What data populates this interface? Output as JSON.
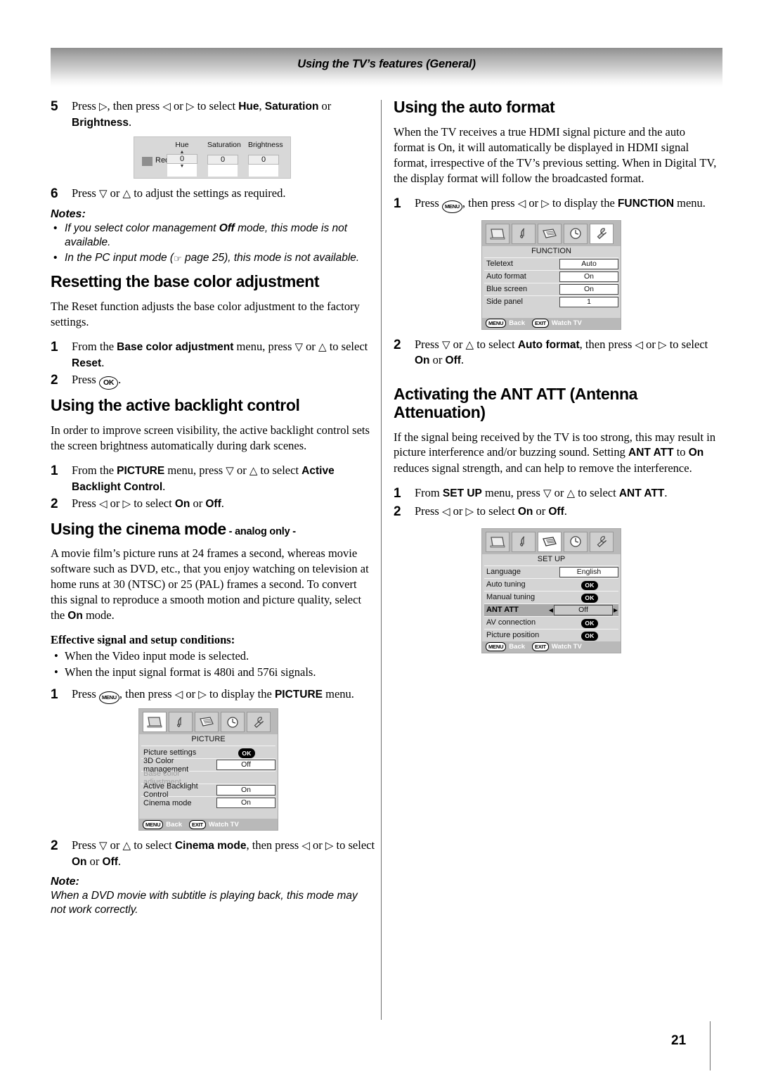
{
  "header": {
    "title": "Using the TV’s features (General)"
  },
  "page": {
    "number": "21"
  },
  "left": {
    "step5": {
      "num": "5",
      "t1": "Press ",
      "arrow1": "▷",
      "t2": ", then press ",
      "arrow2": "◁",
      "t3": " or ",
      "arrow3": "▷",
      "t4": " to select ",
      "b1": "Hue",
      "t5": ", ",
      "b2": "Saturation",
      "t6": " or ",
      "b3": "Brightness",
      "t7": "."
    },
    "hsb": {
      "swatch_label": "Red",
      "columns": [
        {
          "label": "Hue",
          "value": "0",
          "spinner": true
        },
        {
          "label": "Saturation",
          "value": "0",
          "spinner": false
        },
        {
          "label": "Brightness",
          "value": "0",
          "spinner": false
        }
      ]
    },
    "step6": {
      "num": "6",
      "t1": "Press ",
      "arrow1": "▽",
      "t2": " or ",
      "arrow2": "△",
      "t3": " to adjust the settings as required."
    },
    "notes_title": "Notes:",
    "notes": [
      {
        "a": "If you select color management ",
        "b": "Off",
        "c": " mode, this mode is not available."
      },
      {
        "a": "In the PC input mode (",
        "hand": "☞",
        "b": " page 25",
        "c": "), this mode is not available."
      }
    ],
    "reset": {
      "heading": "Resetting the base color adjustment",
      "body": "The Reset function adjusts the base color adjustment to the factory settings.",
      "step1": {
        "num": "1",
        "t1": "From the ",
        "b1": "Base color adjustment",
        "t2": " menu, press ",
        "arrow1": "▽",
        "t3": " or ",
        "arrow2": "△",
        "t4": " to select ",
        "b2": "Reset",
        "t5": "."
      },
      "step2": {
        "num": "2",
        "t1": "Press ",
        "key": "OK",
        "t2": "."
      }
    },
    "backlight": {
      "heading": "Using the active backlight control",
      "body": "In order to improve screen visibility, the active backlight control sets the screen brightness automatically during dark scenes.",
      "step1": {
        "num": "1",
        "t1": "From the ",
        "b1": "PICTURE",
        "t2": " menu, press ",
        "arrow1": "▽",
        "t3": " or ",
        "arrow2": "△",
        "t4": " to select ",
        "b2": "Active Backlight Control",
        "t5": "."
      },
      "step2": {
        "num": "2",
        "t1": "Press ",
        "arrow1": "◁",
        "t2": " or ",
        "arrow2": "▷",
        "t3": " to select ",
        "b1": "On",
        "t4": " or ",
        "b2": "Off",
        "t5": "."
      }
    },
    "cinema": {
      "heading": "Using the cinema mode",
      "heading_suffix": " - analog only -",
      "body1": "A movie film’s picture runs at 24 frames a second, whereas movie software such as DVD, etc., that you enjoy watching on television at home runs at 30 (NTSC) or 25 (PAL) frames a second. To convert this signal to reproduce a smooth motion and picture quality, select the ",
      "body1_b": "On",
      "body1_end": " mode.",
      "eff_title": "Effective signal and setup conditions:",
      "eff_items": [
        "When the Video input mode is selected.",
        "When the input signal format is 480i and 576i signals."
      ],
      "step1": {
        "num": "1",
        "t1": "Press ",
        "key": "MENU",
        "t2": ", then press ",
        "arrow1": "◁",
        "t3": " or ",
        "arrow2": "▷",
        "t4": " to display the ",
        "b1": "PICTURE",
        "t5": " menu."
      },
      "step2": {
        "num": "2",
        "t1": "Press ",
        "arrow1": "▽",
        "t2": " or ",
        "arrow2": "△",
        "t3": " to select ",
        "b1": "Cinema mode",
        "t4": ", then press ",
        "arrow3": "◁",
        "t5": " or ",
        "arrow4": "▷",
        "t6": " to select ",
        "b2": "On",
        "t7": " or ",
        "b3": "Off",
        "t8": "."
      },
      "note_title": "Note:",
      "note_body": "When a DVD movie with subtitle is playing back, this mode may not work correctly."
    }
  },
  "right": {
    "autoformat": {
      "heading": "Using the auto format",
      "body": "When the TV receives a true HDMI signal picture and the auto format is On, it will automatically be displayed in HDMI signal format, irrespective of the TV’s previous setting. When in Digital TV, the display format will follow the broadcasted format.",
      "step1": {
        "num": "1",
        "t1": "Press ",
        "key": "MENU",
        "t2": ", then press ",
        "arrow1": "◁",
        "t3": " or ",
        "arrow2": "▷",
        "t4": " to display the ",
        "b1": "FUNCTION",
        "t5": " menu."
      },
      "step2": {
        "num": "2",
        "t1": "Press ",
        "arrow1": "▽",
        "t2": " or ",
        "arrow2": "△",
        "t3": " to select ",
        "b1": "Auto format",
        "t4": ", then press ",
        "arrow3": "◁",
        "t5": " or ",
        "arrow4": "▷",
        "t6": " to select ",
        "b2": "On",
        "t7": " or ",
        "b3": "Off",
        "t8": "."
      }
    },
    "antatt": {
      "heading": "Activating the ANT ATT (Antenna Attenuation)",
      "body_a": "If the signal being received by the TV is too strong, this may result in picture interference and/or buzzing sound. Setting ",
      "body_b1": "ANT ATT",
      "body_mid": " to ",
      "body_b2": "On",
      "body_end": " reduces signal strength, and can help to remove the interference.",
      "step1": {
        "num": "1",
        "t1": "From ",
        "b1": "SET UP",
        "t2": " menu, press ",
        "arrow1": "▽",
        "t3": " or ",
        "arrow2": "△",
        "t4": " to select ",
        "b2": "ANT ATT",
        "t5": "."
      },
      "step2": {
        "num": "2",
        "t1": "Press ",
        "arrow1": "◁",
        "t2": " or ",
        "arrow2": "▷",
        "t3": " to select ",
        "b1": "On",
        "t4": " or ",
        "b2": "Off",
        "t5": "."
      }
    }
  },
  "osd": {
    "tab_icons": [
      "tv-icon",
      "music-note-icon",
      "list-icon",
      "clock-icon",
      "wrench-icon"
    ],
    "footer": {
      "menu_key": "MENU",
      "menu_text": "Back",
      "exit_key": "EXIT",
      "exit_text": "Watch TV"
    },
    "picture": {
      "name": "PICTURE",
      "active_tab": 0,
      "rows": [
        {
          "label": "Picture settings",
          "value": "OK",
          "type": "ok",
          "dim": false,
          "selected": false
        },
        {
          "label": "3D Color management",
          "value": "Off",
          "type": "box",
          "dim": false,
          "selected": false
        },
        {
          "label": "Base color adjustment",
          "value": "",
          "type": "none",
          "dim": true,
          "selected": false
        },
        {
          "label": "Active Backlight Control",
          "value": "On",
          "type": "box",
          "dim": false,
          "selected": false
        },
        {
          "label": "Cinema mode",
          "value": "On",
          "type": "box",
          "dim": false,
          "selected": false
        }
      ]
    },
    "function": {
      "name": "FUNCTION",
      "active_tab": 4,
      "rows": [
        {
          "label": "Teletext",
          "value": "Auto",
          "type": "box",
          "dim": false,
          "selected": false
        },
        {
          "label": "Auto format",
          "value": "On",
          "type": "box",
          "dim": false,
          "selected": false
        },
        {
          "label": "Blue screen",
          "value": "On",
          "type": "box",
          "dim": false,
          "selected": false
        },
        {
          "label": "Side panel",
          "value": "1",
          "type": "box",
          "dim": false,
          "selected": false
        }
      ]
    },
    "setup": {
      "name": "SET UP",
      "active_tab": 2,
      "rows": [
        {
          "label": "Language",
          "value": "English",
          "type": "box",
          "dim": false,
          "selected": false
        },
        {
          "label": "Auto tuning",
          "value": "OK",
          "type": "ok",
          "dim": false,
          "selected": false
        },
        {
          "label": "Manual tuning",
          "value": "OK",
          "type": "ok",
          "dim": false,
          "selected": false
        },
        {
          "label": "ANT ATT",
          "value": "Off",
          "type": "box",
          "dim": false,
          "selected": true
        },
        {
          "label": "AV connection",
          "value": "OK",
          "type": "ok",
          "dim": false,
          "selected": false
        },
        {
          "label": "Picture position",
          "value": "OK",
          "type": "ok",
          "dim": false,
          "selected": false
        }
      ]
    }
  }
}
